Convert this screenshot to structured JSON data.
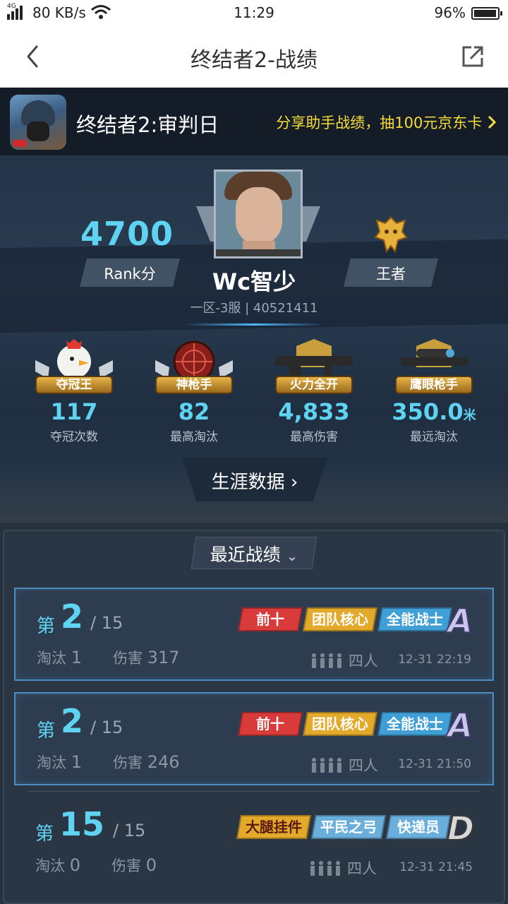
{
  "status_bar": {
    "network": "4G",
    "speed": "80 KB/s",
    "time": "11:29",
    "battery": "96%"
  },
  "header": {
    "title": "终结者2-战绩"
  },
  "banner": {
    "game_name": "终结者2:审判日",
    "promo": "分享助手战绩，抽100元京东卡"
  },
  "profile": {
    "rank_score": "4700",
    "rank_label": "Rank分",
    "player_name": "Wc智少",
    "server": "一区-3服 | 40521411",
    "tier": "王者"
  },
  "stats": [
    {
      "badge": "夺冠王",
      "value": "117",
      "unit": "",
      "caption": "夺冠次数"
    },
    {
      "badge": "神枪手",
      "value": "82",
      "unit": "",
      "caption": "最高淘汰"
    },
    {
      "badge": "火力全开",
      "value": "4,833",
      "unit": "",
      "caption": "最高伤害"
    },
    {
      "badge": "鹰眼枪手",
      "value": "350.0",
      "unit": "米",
      "caption": "最远淘汰"
    }
  ],
  "career_button": "生涯数据 ›",
  "recent_tab": "最近战绩",
  "recent_arrow": "⌄",
  "matches": [
    {
      "prefix": "第",
      "place": "2",
      "total": "/ 15",
      "kills_label": "淘汰",
      "kills": "1",
      "damage_label": "伤害",
      "damage": "317",
      "tags": [
        "前十",
        "团队核心",
        "全能战士"
      ],
      "grade": "A",
      "team": "四人",
      "date": "12-31 22:19"
    },
    {
      "prefix": "第",
      "place": "2",
      "total": "/ 15",
      "kills_label": "淘汰",
      "kills": "1",
      "damage_label": "伤害",
      "damage": "246",
      "tags": [
        "前十",
        "团队核心",
        "全能战士"
      ],
      "grade": "A",
      "team": "四人",
      "date": "12-31 21:50"
    },
    {
      "prefix": "第",
      "place": "15",
      "total": "/ 15",
      "kills_label": "淘汰",
      "kills": "0",
      "damage_label": "伤害",
      "damage": "0",
      "tags": [
        "大腿挂件",
        "平民之弓",
        "快递员"
      ],
      "grade": "D",
      "team": "四人",
      "date": "12-31 21:45"
    }
  ],
  "colors": {
    "accent": "#5fd4f2",
    "promo": "#f6dd3a",
    "tag_red": "#d93a3a",
    "tag_gold": "#e2a92b",
    "tag_blue": "#3f9fd6"
  }
}
